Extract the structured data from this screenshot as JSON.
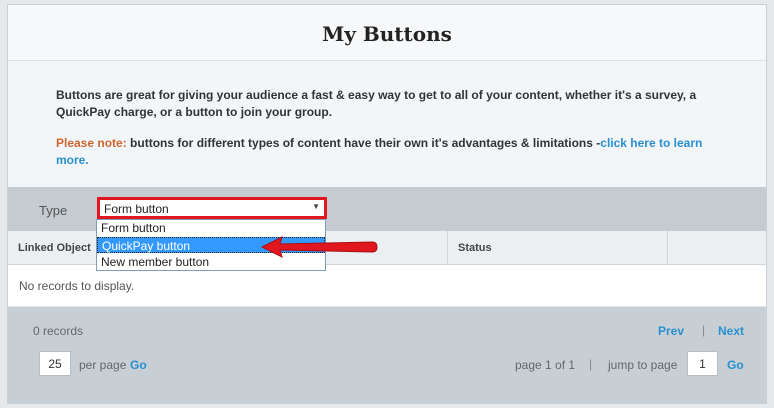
{
  "header": {
    "title": "My Buttons"
  },
  "intro": {
    "text": "Buttons are great for giving your audience a fast & easy way to get to all of your content, whether it's a survey, a QuickPay charge, or a button to join your group.",
    "note_label": "Please note:",
    "note_text": " buttons for different types of content have their own it's advantages & limitations -",
    "note_link": "click here to learn more."
  },
  "filter": {
    "type_label": "Type",
    "selected": "Form button",
    "options": [
      "Form button",
      "QuickPay button",
      "New member button"
    ],
    "highlighted_option": "QuickPay button"
  },
  "table": {
    "columns": [
      "Linked Object",
      "",
      "Status",
      ""
    ],
    "empty_message": "No records to display."
  },
  "pager": {
    "records": "0 records",
    "prev": "Prev",
    "separator": "|",
    "next": "Next",
    "per_page_value": "25",
    "per_page_label": "per page",
    "go": "Go",
    "page_of": "page 1 of 1",
    "jump_label": "jump to page",
    "jump_value": "1"
  },
  "colors": {
    "accent_red": "#e0171e",
    "link_blue": "#2a8fd0",
    "note_orange": "#d0662e",
    "highlight_blue": "#3399ff"
  }
}
